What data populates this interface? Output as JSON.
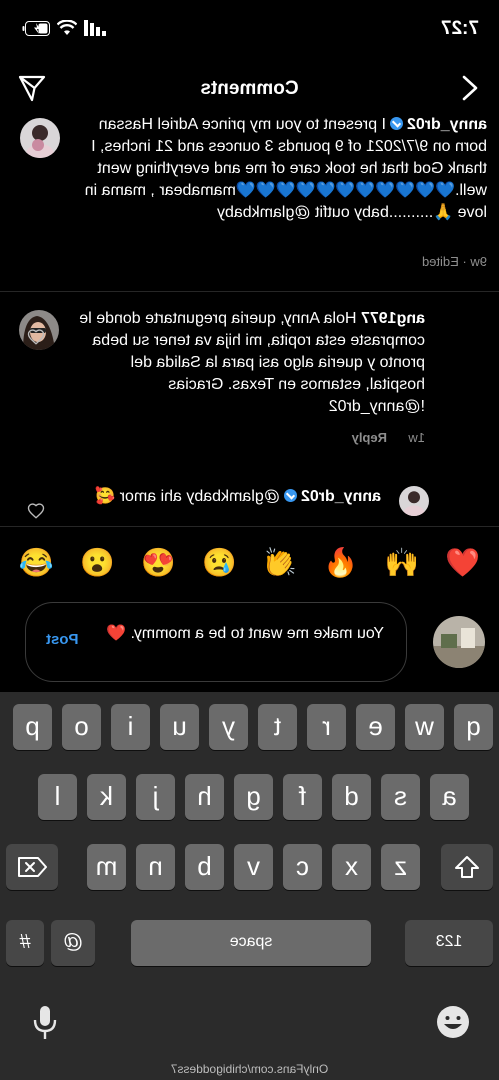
{
  "status_bar": {
    "time": "7:27"
  },
  "header": {
    "title": "Comments"
  },
  "comments": [
    {
      "username": "anny_dr02",
      "text": "I present to you my prince Adriel Hassan  born on 9/7/2021 of 9 pounds 3 ounces and 21  inches, I thank God that he took care of me and everything went well.💙💙💙💙💙💙💙💙💙💙💙mamabear , mama in love 🙏..........baby outfit @glamkbaby",
      "meta": "9w · Edited"
    },
    {
      "username": "ang1977",
      "text": "Hola Anny, queria preguntarte donde le compraste esta ropita, mi hija va tener su beba pronto y queria algo asi para la Salida del hospital, estamos en Texas. Gracias !@anny_dr02",
      "time": "1w",
      "reply": "Reply"
    },
    {
      "username": "anny_dr02",
      "text": "@glamkbaby ahi amor 🥰"
    }
  ],
  "emoji_bar": [
    "❤️",
    "🙌",
    "🔥",
    "👏",
    "😢",
    "😍",
    "😮",
    "😂"
  ],
  "composer": {
    "text": "You make me want to be a mommy. ❤️",
    "post_label": "Post"
  },
  "keyboard": {
    "row1": [
      "q",
      "w",
      "e",
      "r",
      "t",
      "y",
      "u",
      "i",
      "o",
      "p"
    ],
    "row2": [
      "a",
      "s",
      "d",
      "f",
      "g",
      "h",
      "j",
      "k",
      "l"
    ],
    "row3": [
      "z",
      "x",
      "c",
      "v",
      "b",
      "n",
      "m"
    ],
    "numbers": "123",
    "space": "space",
    "at": "@",
    "hash": "#"
  },
  "watermark": "OnlyFans.com/chibigoddess7"
}
